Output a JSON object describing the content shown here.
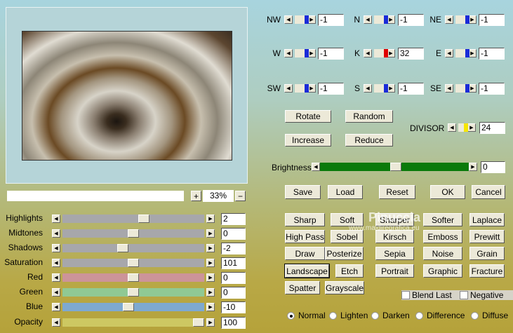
{
  "preview": {
    "zoom": "33%",
    "zoom_in": "+",
    "zoom_out": "−",
    "progress_segments": 25
  },
  "sliders": [
    {
      "label": "Highlights",
      "value": "2",
      "pos": 0.58,
      "color": "#a7a7ab"
    },
    {
      "label": "Midtones",
      "value": "0",
      "pos": 0.5,
      "color": "#a7a7ab"
    },
    {
      "label": "Shadows",
      "value": "-2",
      "pos": 0.42,
      "color": "#a7a7ab"
    },
    {
      "label": "Saturation",
      "value": "101",
      "pos": 0.5,
      "color": "#a7a7ab"
    },
    {
      "label": "Red",
      "value": "0",
      "pos": 0.5,
      "color": "#cc9499"
    },
    {
      "label": "Green",
      "value": "0",
      "pos": 0.5,
      "color": "#90c994"
    },
    {
      "label": "Blue",
      "value": "-10",
      "pos": 0.46,
      "color": "#7ea9cf"
    },
    {
      "label": "Opacity",
      "value": "100",
      "pos": 1.0,
      "color": "#cdc862"
    }
  ],
  "matrix": [
    {
      "label": "NW",
      "value": "-1"
    },
    {
      "label": "N",
      "value": "-1"
    },
    {
      "label": "NE",
      "value": "-1"
    },
    {
      "label": "W",
      "value": "-1"
    },
    {
      "label": "K",
      "value": "32",
      "accent": "#e00000"
    },
    {
      "label": "E",
      "value": "-1"
    },
    {
      "label": "SW",
      "value": "-1"
    },
    {
      "label": "S",
      "value": "-1"
    },
    {
      "label": "SE",
      "value": "-1"
    }
  ],
  "matrix_buttons": {
    "rotate": "Rotate",
    "random": "Random",
    "increase": "Increase",
    "reduce": "Reduce"
  },
  "divisor": {
    "label": "DIVISOR",
    "value": "24",
    "accent": "#f5e600"
  },
  "brightness": {
    "label": "Brightness",
    "value": "0",
    "pos": 0.5,
    "color": "#0a7a0a"
  },
  "actions": {
    "save": "Save",
    "load": "Load",
    "reset": "Reset",
    "ok": "OK",
    "cancel": "Cancel"
  },
  "presets": [
    [
      "Sharp",
      "Soft",
      "Sharper",
      "Softer",
      "Laplace"
    ],
    [
      "High Pass",
      "Sobel",
      "Kirsch",
      "Emboss",
      "Prewitt"
    ],
    [
      "Draw",
      "Posterize",
      "Sepia",
      "Noise",
      "Grain"
    ],
    [
      "Landscape",
      "Etch",
      "Portrait",
      "Graphic",
      "Fracture"
    ],
    [
      "Spatter",
      "Grayscale"
    ]
  ],
  "options": {
    "blend_last": "Blend Last",
    "negative": "Negative"
  },
  "modes": [
    {
      "label": "Normal",
      "selected": true
    },
    {
      "label": "Lighten"
    },
    {
      "label": "Darken"
    },
    {
      "label": "Difference"
    },
    {
      "label": "Diffuse"
    }
  ],
  "watermark": {
    "name": "Pinuccia",
    "url": "www.maidiregrafica.eu"
  }
}
